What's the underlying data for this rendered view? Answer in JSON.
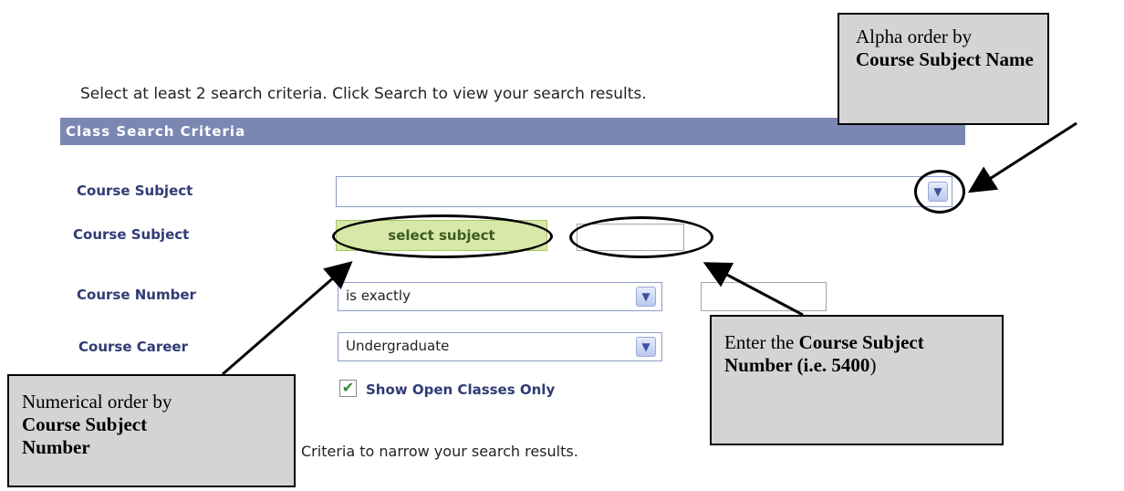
{
  "instructions": "Select at least 2 search criteria. Click Search to view your search results.",
  "panel": {
    "title": "Class Search Criteria"
  },
  "form": {
    "course_subject_label": "Course Subject",
    "course_subject_alt_label": "Course Subject",
    "select_subject_button": "select subject",
    "course_subject_number_value": "",
    "course_number_label": "Course Number",
    "course_number_operator": "is exactly",
    "course_number_value": "",
    "course_career_label": "Course Career",
    "course_career_value": "Undergraduate",
    "open_classes_label": "Show Open Classes Only",
    "open_classes_checked": true
  },
  "hint_text": "Criteria to narrow your search results.",
  "callouts": {
    "alpha_line1": "Alpha order by",
    "alpha_bold": "Course Subject Name",
    "numerical_line1": "Numerical order by",
    "numerical_bold": "Course Subject Number",
    "enter_prefix": "Enter the ",
    "enter_bold": "Course Subject Number (i.e. 5400",
    "enter_suffix": ")"
  },
  "colors": {
    "header_bg": "#7b87b3",
    "label_color": "#2f3b74",
    "select_button_bg": "#d7e8a8",
    "callout_bg": "#d4d4d4"
  }
}
